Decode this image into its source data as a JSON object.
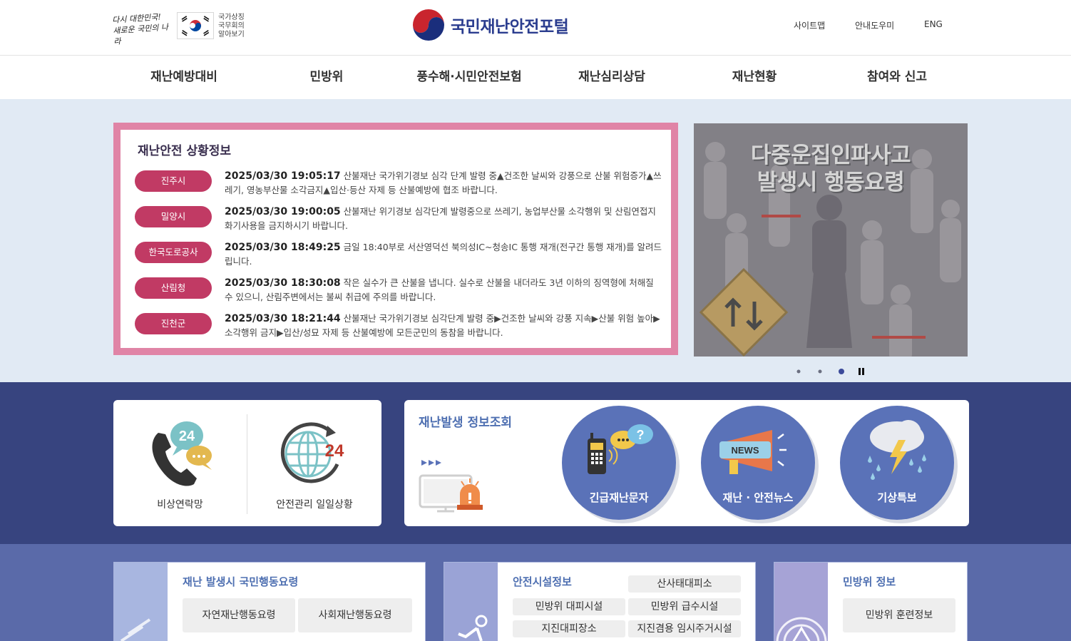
{
  "header": {
    "slogan": [
      "다시 대한민국!",
      "새로운 국민의 나라"
    ],
    "symbol_text": [
      "국가상징",
      "국무회의",
      "알아보기"
    ],
    "logo_text": "국민재난안전포털",
    "util_links": [
      "사이트맵",
      "안내도우미",
      "ENG"
    ]
  },
  "nav": {
    "items": [
      "재난예방대비",
      "민방위",
      "풍수해·시민안전보험",
      "재난심리상담",
      "재난현황",
      "참여와 신고"
    ]
  },
  "situation": {
    "title": "재난안전 상황정보",
    "items": [
      {
        "source": "진주시",
        "time": "2025/03/30 19:05:17",
        "text": "산불재난 국가위기경보 심각 단계 발령 중▲건조한 날씨와 강풍으로 산불 위험증가▲쓰레기, 영농부산물 소각금지▲입산·등산 자제 등 산불예방에 협조 바랍니다."
      },
      {
        "source": "밀양시",
        "time": "2025/03/30 19:00:05",
        "text": "산불재난 위기경보 심각단계 발령중으로 쓰레기, 농업부산물 소각행위 및 산림연접지 화기사용을 금지하시기 바랍니다."
      },
      {
        "source": "한국도로공사",
        "time": "2025/03/30 18:49:25",
        "text": "금일 18:40부로 서산영덕선 북의성IC~청송IC 통행 재개(전구간 통행 재개)를 알려드립니다."
      },
      {
        "source": "산림청",
        "time": "2025/03/30 18:30:08",
        "text": "작은 실수가 큰 산불을 냅니다. 실수로 산불을 내더라도 3년 이하의 징역형에 처해질 수 있으니, 산림주변에서는 불씨 취급에 주의를 바랍니다."
      },
      {
        "source": "진천군",
        "time": "2025/03/30 18:21:44",
        "text": "산불재난 국가위기경보 심각단계 발령 중▶건조한 날씨와 강풍 지속▶산불 위험 높아▶소각행위 금지▶입산/성묘 자제 등 산불예방에 모든군민의 동참을 바랍니다."
      }
    ]
  },
  "banner": {
    "title_line1": "다중운집인파사고",
    "title_line2": "발생시 행동요령"
  },
  "quick": {
    "emergency_contact": "비상연락망",
    "daily_status": "안전관리 일일상황",
    "num_24": "24"
  },
  "disaster_info": {
    "title": "재난발생 정보조회",
    "items": [
      "긴급재난문자",
      "재난 · 안전뉴스",
      "기상특보"
    ],
    "news_badge": "NEWS"
  },
  "panels": {
    "guide": {
      "title": "재난 발생시 국민행동요령",
      "buttons": [
        "자연재난행동요령",
        "사회재난행동요령"
      ]
    },
    "facility": {
      "title": "안전시설정보",
      "buttons": [
        "산사태대피소",
        "민방위 대피시설",
        "민방위 급수시설",
        "지진대피장소",
        "지진겸용 임시주거시설"
      ]
    },
    "civil": {
      "title": "민방위 정보",
      "buttons": [
        "민방위 훈련정보"
      ]
    }
  },
  "colors": {
    "brand_navy": "#2b3d8f",
    "situation_border": "#e084a6",
    "badge": "#c13a64",
    "band": "#37447f",
    "circle": "#5a72b8",
    "lower_bg": "#5a6aa9"
  }
}
